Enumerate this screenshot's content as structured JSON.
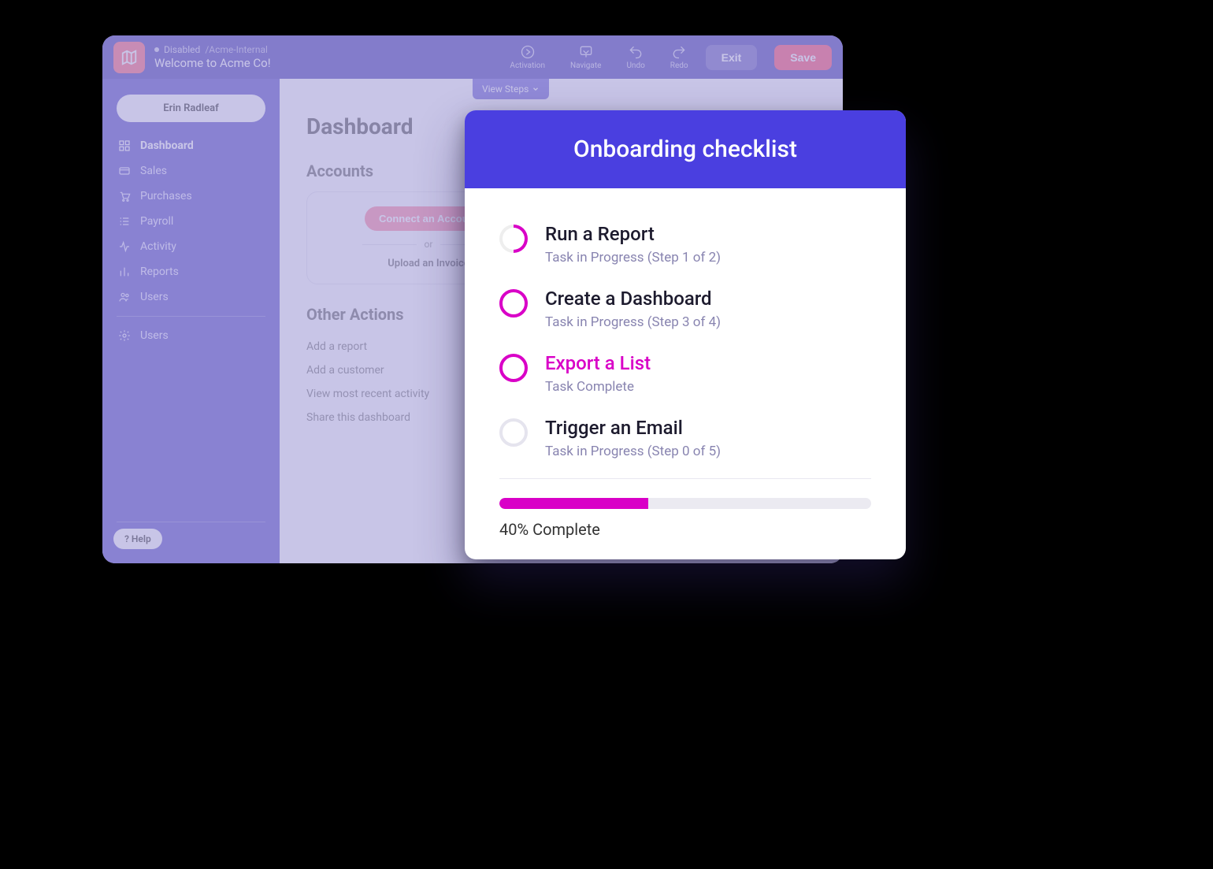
{
  "header": {
    "status_label": "Disabled",
    "path": "/Acme-Internal",
    "welcome": "Welcome to Acme Co!",
    "tools": {
      "activation": "Activation",
      "navigate": "Navigate",
      "undo": "Undo",
      "redo": "Redo"
    },
    "exit_label": "Exit",
    "save_label": "Save"
  },
  "sidebar": {
    "user_name": "Erin Radleaf",
    "items": [
      {
        "label": "Dashboard"
      },
      {
        "label": "Sales"
      },
      {
        "label": "Purchases"
      },
      {
        "label": "Payroll"
      },
      {
        "label": "Activity"
      },
      {
        "label": "Reports"
      },
      {
        "label": "Users"
      }
    ],
    "settings_label": "Users",
    "help_label": "? Help"
  },
  "view_steps_label": "View Steps",
  "main": {
    "title": "Dashboard",
    "accounts_heading": "Accounts",
    "connect_label": "Connect an Account",
    "or_label": "or",
    "upload_label": "Upload an Invoice",
    "other_heading": "Other Actions",
    "actions": [
      "Add a report",
      "Add a customer",
      "View most recent activity",
      "Share this dashboard"
    ]
  },
  "checklist": {
    "title": "Onboarding checklist",
    "items": [
      {
        "title": "Run a Report",
        "subtitle": "Task in Progress (Step 1 of 2)",
        "state": "partial"
      },
      {
        "title": "Create a Dashboard",
        "subtitle": "Task in Progress (Step 3 of 4)",
        "state": "ring"
      },
      {
        "title": "Export a List",
        "subtitle": "Task Complete",
        "state": "highlight"
      },
      {
        "title": "Trigger an Email",
        "subtitle": "Task in Progress (Step 0 of 5)",
        "state": "inactive"
      }
    ],
    "progress_percent": 40,
    "progress_label": "40% Complete"
  }
}
